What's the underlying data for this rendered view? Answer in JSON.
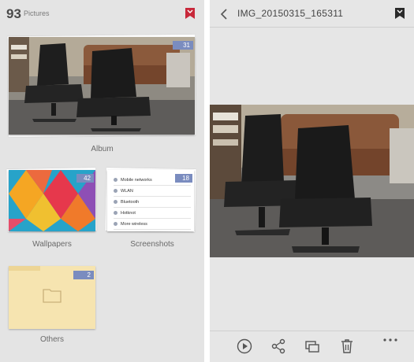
{
  "gallery": {
    "count": "93",
    "count_label": "Pictures",
    "albums": [
      {
        "name": "Album",
        "count": "31"
      },
      {
        "name": "Wallpapers",
        "count": "42"
      },
      {
        "name": "Screenshots",
        "count": "18"
      },
      {
        "name": "Others",
        "count": "2"
      }
    ],
    "screenshot_preview": [
      "Mobile networks",
      "WLAN",
      "Bluetooth",
      "Hotknot",
      "More wireless"
    ]
  },
  "viewer": {
    "title": "IMG_20150315_165311",
    "toolbar": [
      "play-icon",
      "share-icon",
      "slideshow-icon",
      "trash-icon",
      "more-icon"
    ]
  },
  "colors": {
    "accent_red": "#c8283a",
    "badge_blue": "#7a8cbf",
    "folder_yellow": "#f6e4b0"
  }
}
